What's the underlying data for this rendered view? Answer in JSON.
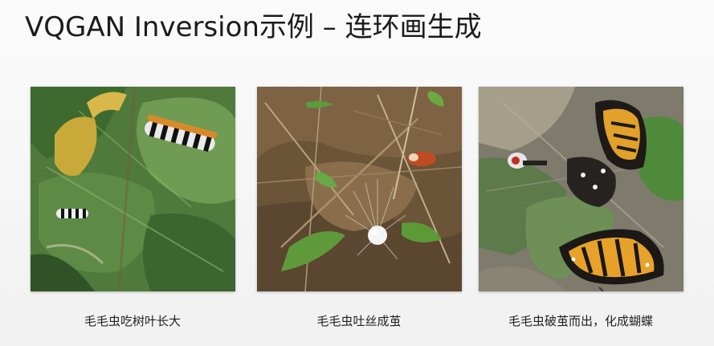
{
  "slide": {
    "title": "VQGAN Inversion示例 – 连环画生成"
  },
  "panels": [
    {
      "caption": "毛毛虫吃树叶长大"
    },
    {
      "caption": "毛毛虫吐丝成茧"
    },
    {
      "caption": "毛毛虫破茧而出，化成蝴蝶"
    }
  ]
}
